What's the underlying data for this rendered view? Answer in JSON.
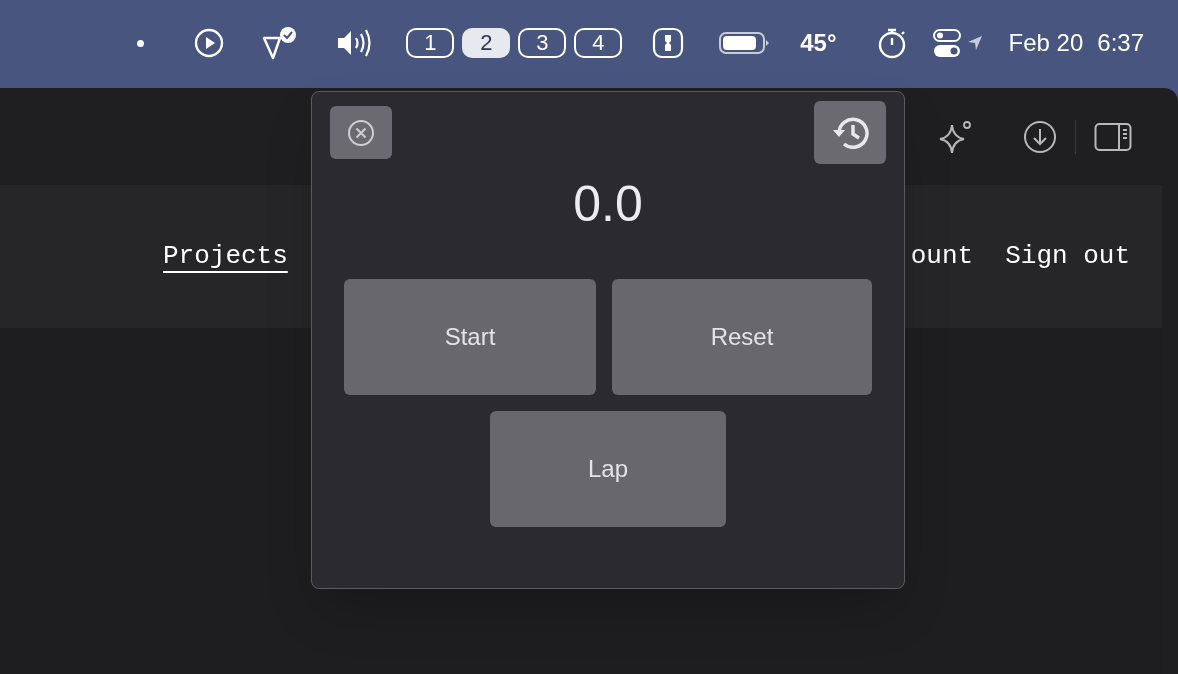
{
  "menu_bar": {
    "desktops": [
      {
        "label": "1",
        "selected": false
      },
      {
        "label": "2",
        "selected": true
      },
      {
        "label": "3",
        "selected": false
      },
      {
        "label": "4",
        "selected": false
      }
    ],
    "temperature": "45°",
    "date": "Feb 20",
    "time": "6:37"
  },
  "page_nav": [
    {
      "label": "Projects",
      "selected": true
    },
    {
      "label": "ount",
      "selected": false
    },
    {
      "label": "Sign out",
      "selected": false
    }
  ],
  "stopwatch": {
    "reading": "0.0",
    "buttons": [
      {
        "label": "Start"
      },
      {
        "label": "Reset"
      },
      {
        "label": "Lap"
      }
    ]
  }
}
